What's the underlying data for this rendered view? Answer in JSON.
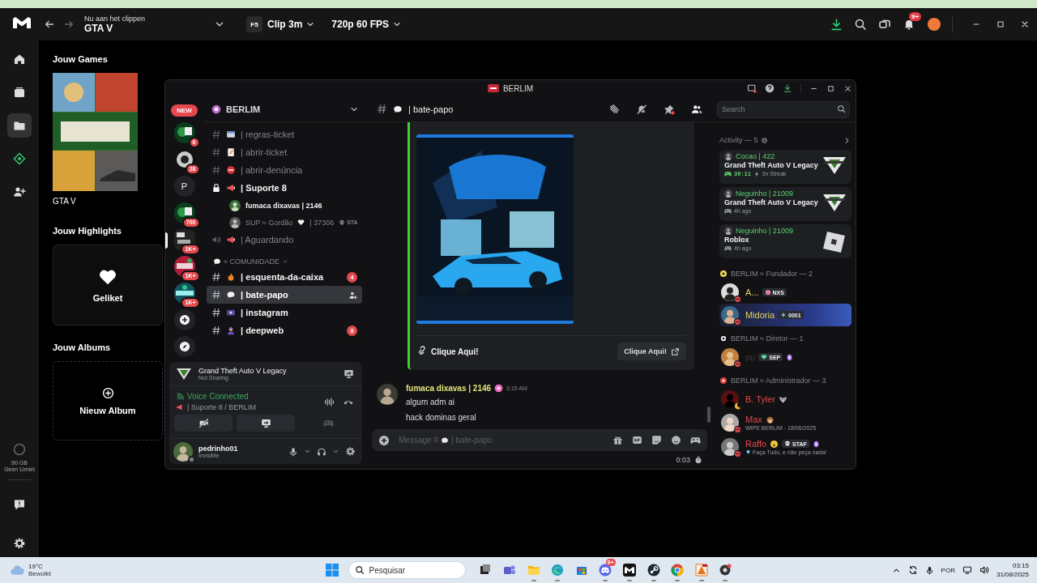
{
  "medal": {
    "clip_label": "Nu aan het clippen",
    "game": "GTA V",
    "hotkey": "F5",
    "clip_length": "Clip 3m",
    "quality": "720p 60 FPS",
    "notifications": "9+",
    "nav": [
      {
        "kind": "home",
        "selected": false
      },
      {
        "kind": "clips",
        "selected": false
      },
      {
        "kind": "library",
        "selected": true
      },
      {
        "kind": "diamond",
        "selected": false
      },
      {
        "kind": "friends",
        "selected": false
      }
    ],
    "storage": {
      "amount": "90 GB",
      "limit": "Geen Limiet"
    },
    "games_title": "Jouw Games",
    "games": [
      {
        "name": "GTA V"
      }
    ],
    "highlights_title": "Jouw Highlights",
    "highlights": [
      {
        "label": "Geliket"
      }
    ],
    "albums_title": "Jouw Albums",
    "new_album": "Nieuw Album"
  },
  "discord": {
    "title": "BERLIM",
    "server_name": "BERLIM",
    "servers": [
      {
        "kind": "new",
        "label": "NEW",
        "selected": false
      },
      {
        "kind": "icon",
        "badge": "6",
        "selected": false
      },
      {
        "kind": "icon",
        "badge": "28",
        "selected": false
      },
      {
        "kind": "letter",
        "label": "P",
        "selected": false
      },
      {
        "kind": "icon",
        "badge": "700",
        "selected": false
      },
      {
        "kind": "icon",
        "badge": "1K+",
        "selected": true
      },
      {
        "kind": "icon",
        "badge": "1K+",
        "selected": false
      },
      {
        "kind": "icon",
        "badge": "1K+",
        "selected": false
      },
      {
        "kind": "add",
        "selected": false
      },
      {
        "kind": "discover",
        "selected": false
      }
    ],
    "channels": [
      {
        "kind": "text",
        "name": "| regras-ticket",
        "unread": false,
        "selected": false
      },
      {
        "kind": "text",
        "name": "| abrir-ticket",
        "unread": false,
        "selected": false
      },
      {
        "kind": "text",
        "name": "| abrir-denúncia",
        "unread": false,
        "selected": false
      },
      {
        "kind": "voice-locked",
        "name": "| Suporte 8",
        "unread": true,
        "selected": false
      },
      {
        "kind": "user",
        "name": "fumaca dixavas | 2146",
        "unread": true
      },
      {
        "kind": "user",
        "name": "SUP ≈ Gordão",
        "suffix": "| 37306",
        "tag": "STA",
        "unread": false
      },
      {
        "kind": "voice",
        "name": "| Aguardando",
        "unread": false,
        "selected": false
      },
      {
        "kind": "category",
        "name": "≈ COMUNIDADE"
      },
      {
        "kind": "text",
        "name": "| esquenta-da-caixa",
        "unread": true,
        "badge": "4",
        "selected": false
      },
      {
        "kind": "text",
        "name": "| bate-papo",
        "unread": true,
        "selected": true
      },
      {
        "kind": "text",
        "name": "| instagram",
        "unread": true,
        "selected": false
      },
      {
        "kind": "text",
        "name": "| deepweb",
        "unread": true,
        "badge": "8",
        "selected": false
      }
    ],
    "activity_game": "Grand Theft Auto V Legacy",
    "activity_status": "Not Sharing",
    "voice_status": "Voice Connected",
    "voice_channel": "| Suporte 8 / BERLIM",
    "username": "pedrinho01",
    "user_status": "Invisible",
    "chat": {
      "channel": "| bate-papo",
      "embed": {
        "link": "Clique Aqui!",
        "button": "Clique Aqui!"
      },
      "messages": [
        {
          "author": "fumaca dixavas | 2146",
          "time": "3:15 AM",
          "lines": [
            "algum adm ai",
            "hack dominas geral"
          ]
        }
      ],
      "hint_start": "Message #",
      "hint_end": "| bate-papo",
      "timer": "0:03"
    },
    "members": {
      "search_placeholder": "Search",
      "activity_title": "Activity — 5",
      "activities": [
        {
          "kind": "gta",
          "user": "Cocao | 422",
          "game": "Grand Theft Auto V Legacy",
          "time": "30:11",
          "streak": "5x Streak"
        },
        {
          "kind": "gta",
          "user": "Neguinho | 21009",
          "game": "Grand Theft Auto V Legacy",
          "time": "4h ago"
        },
        {
          "kind": "roblox",
          "user": "Neguinho | 21009",
          "game": "Roblox",
          "time": "4h ago"
        }
      ],
      "groups": [
        {
          "title": "BERLIM ≈ Fundador — 2",
          "members": [
            {
              "name": "A...",
              "tag": "NXS",
              "color": "#e3d35a",
              "kind": "dnd",
              "nameplate": false
            },
            {
              "name": "Midoria",
              "tag": "0001",
              "color": "#e3d35a",
              "kind": "dnd",
              "nameplate": true
            }
          ]
        },
        {
          "title": "BERLIM ≈ Diretor — 1",
          "members": [
            {
              "name": "pu",
              "tag": "SEP",
              "color": "#3a3a3e",
              "kind": "dnd",
              "nameplate": false
            }
          ]
        },
        {
          "title": "BERLIM ≈ Administrador — 3",
          "members": [
            {
              "name": "B. Tyler",
              "color": "#e5484d",
              "kind": "idle",
              "nameplate": false
            },
            {
              "name": "Max",
              "subtitle": "WIPE BERLIM - 18/06/2025",
              "color": "#e5484d",
              "kind": "dnd",
              "nameplate": false
            },
            {
              "name": "Raffo",
              "tag": "STAF",
              "subtitle": "Faça Tudo, e não peça nada!",
              "color": "#e5484d",
              "kind": "dnd",
              "nameplate": false
            }
          ]
        }
      ]
    }
  },
  "taskbar": {
    "temperature": "19°C",
    "weather": "Bewolkt",
    "search_placeholder": "Pesquisar",
    "apps": [
      {
        "kind": "taskview",
        "running": false
      },
      {
        "kind": "teams",
        "running": false
      },
      {
        "kind": "explorer",
        "running": true
      },
      {
        "kind": "edge",
        "running": true
      },
      {
        "kind": "store",
        "running": false
      },
      {
        "kind": "discord",
        "badge": "9+",
        "running": true
      },
      {
        "kind": "medal",
        "running": true
      },
      {
        "kind": "steam",
        "running": true
      },
      {
        "kind": "chrome",
        "running": true
      },
      {
        "kind": "orange",
        "running": true
      },
      {
        "kind": "dot",
        "running": true
      }
    ],
    "language": "POR",
    "time": "03:15",
    "date": "31/08/2025"
  }
}
